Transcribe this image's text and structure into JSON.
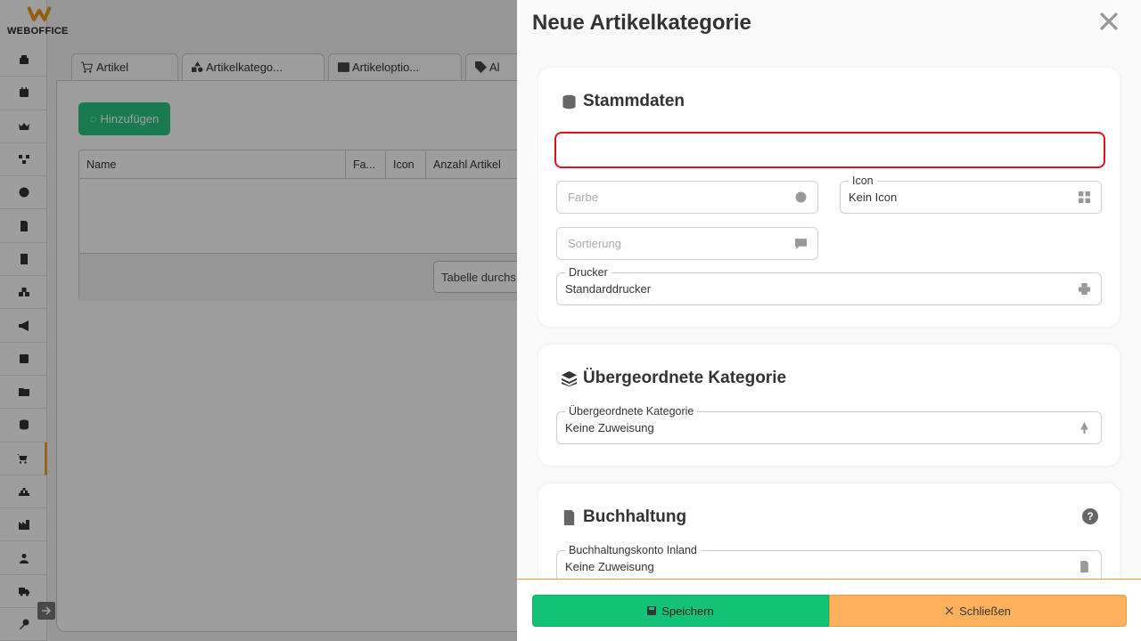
{
  "app": {
    "logo_text": "WEBOFFICE"
  },
  "sidebar": {
    "items": [
      {
        "icon": "cash-register-icon"
      },
      {
        "icon": "calendar-icon"
      },
      {
        "icon": "crown-icon"
      },
      {
        "icon": "network-icon"
      },
      {
        "icon": "clock-icon"
      },
      {
        "icon": "document-icon"
      },
      {
        "icon": "receipt-icon"
      },
      {
        "icon": "cubes-icon"
      },
      {
        "icon": "megaphone-icon"
      },
      {
        "icon": "chart-icon"
      },
      {
        "icon": "folder-icon"
      },
      {
        "icon": "database-icon"
      },
      {
        "icon": "cart-icon",
        "active": true
      },
      {
        "icon": "warehouse-icon"
      },
      {
        "icon": "industry-icon"
      },
      {
        "icon": "users-icon"
      },
      {
        "icon": "truck-icon"
      },
      {
        "icon": "key-icon"
      }
    ]
  },
  "tabs": [
    {
      "label": "Artikel",
      "icon": "cart-icon"
    },
    {
      "label": "Artikelkatego...",
      "icon": "shapes-icon"
    },
    {
      "label": "Artikeloptio...",
      "icon": "options-icon"
    },
    {
      "label": "Al",
      "icon": "tag-icon"
    }
  ],
  "list": {
    "add_button": "Hinzufügen",
    "columns": [
      "Name",
      "Fa...",
      "Icon",
      "Anzahl Artikel"
    ],
    "search_placeholder": "Tabelle durchs"
  },
  "drawer": {
    "title": "Neue Artikelkategorie",
    "sections": {
      "stammdaten": {
        "title": "Stammdaten",
        "name_value": "",
        "farbe_placeholder": "Farbe",
        "icon_label": "Icon",
        "icon_value": "Kein Icon",
        "sortierung_placeholder": "Sortierung",
        "drucker_label": "Drucker",
        "drucker_value": "Standarddrucker"
      },
      "parent": {
        "title": "Übergeordnete Kategorie",
        "field_label": "Übergeordnete Kategorie",
        "field_value": "Keine Zuweisung"
      },
      "buchhaltung": {
        "title": "Buchhaltung",
        "help": "?",
        "konto_label": "Buchhaltungskonto Inland",
        "konto_value": "Keine Zuweisung"
      }
    },
    "footer": {
      "save": "Speichern",
      "close": "Schließen"
    }
  }
}
